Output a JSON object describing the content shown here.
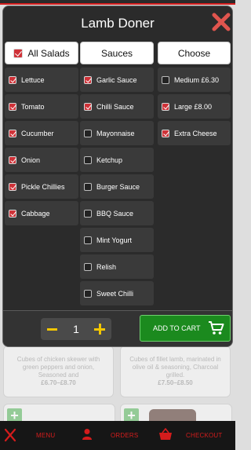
{
  "modal": {
    "title": "Lamb Doner",
    "columns": [
      {
        "header": "All Salads",
        "header_checked": true,
        "options": [
          {
            "label": "Lettuce",
            "checked": true
          },
          {
            "label": "Tomato",
            "checked": true
          },
          {
            "label": "Cucumber",
            "checked": true
          },
          {
            "label": "Onion",
            "checked": true
          },
          {
            "label": "Pickle Chillies",
            "checked": true
          },
          {
            "label": "Cabbage",
            "checked": true
          }
        ]
      },
      {
        "header": "Sauces",
        "options": [
          {
            "label": "Garlic Sauce",
            "checked": true
          },
          {
            "label": "Chilli Sauce",
            "checked": true
          },
          {
            "label": "Mayonnaise",
            "checked": false
          },
          {
            "label": "Ketchup",
            "checked": false
          },
          {
            "label": "Burger Sauce",
            "checked": false
          },
          {
            "label": "BBQ Sauce",
            "checked": false
          },
          {
            "label": "Mint Yogurt",
            "checked": false
          },
          {
            "label": "Relish",
            "checked": false
          },
          {
            "label": "Sweet Chilli",
            "checked": false
          }
        ]
      },
      {
        "header": "Choose",
        "options": [
          {
            "label": "Medium £6.30",
            "checked": false
          },
          {
            "label": "Large £8.00",
            "checked": true
          },
          {
            "label": "Extra Cheese",
            "checked": true
          }
        ]
      }
    ],
    "quantity": "1",
    "add_to_cart_label": "ADD TO CART"
  },
  "background_cards": [
    {
      "desc": "Cubes of chicken skewer with green peppers and onion, Seasoned and",
      "price": "£6.70–£8.70"
    },
    {
      "desc": "Cubes of fillet lamb, marinated in olive oil & seasoning, Charcoal grilled.",
      "price": "£7.50–£8.50"
    }
  ],
  "bottom_nav": {
    "menu": "MENU",
    "orders": "ORDERS",
    "checkout": "CHECKOUT"
  },
  "colors": {
    "accent_red": "#d41c1c",
    "checkbox_red": "#cf3238",
    "cart_green": "#1b8a1e",
    "qty_yellow": "#f2c600",
    "modal_bg": "#2b2b2b"
  }
}
